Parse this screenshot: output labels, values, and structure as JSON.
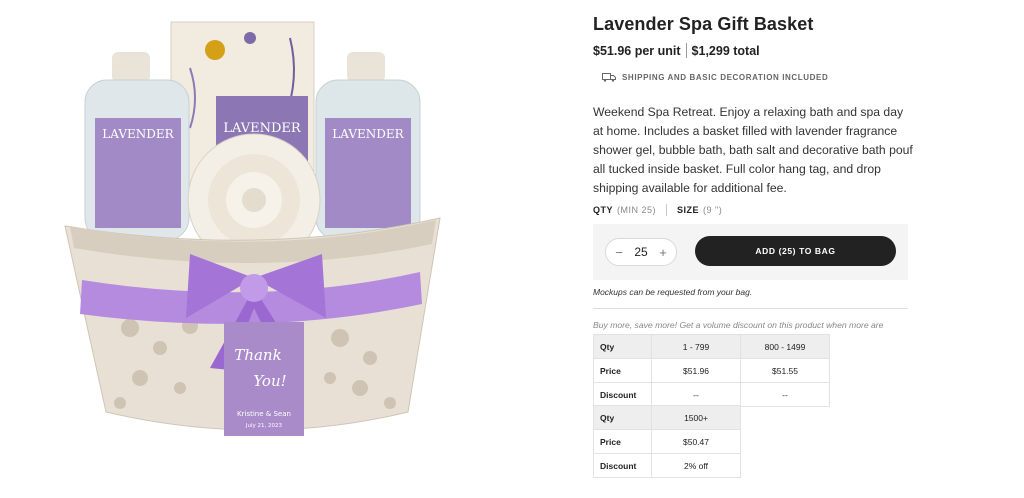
{
  "product": {
    "title": "Lavender Spa Gift Basket",
    "unit_price": "$51.96 per unit",
    "total_price": "$1,299 total",
    "shipping_note": "SHIPPING AND BASIC DECORATION INCLUDED",
    "description": "Weekend Spa Retreat. Enjoy a relaxing bath and spa day at home. Includes a basket filled with lavender fragrance shower gel, bubble bath, bath salt and decorative bath pouf all tucked inside basket. Full color hang tag, and drop shipping available for additional fee."
  },
  "options": {
    "qty_label": "QTY",
    "qty_min": "(MIN 25)",
    "size_label": "SIZE",
    "size_value": "(9 \")"
  },
  "cart": {
    "minus": "−",
    "quantity": "25",
    "plus": "+",
    "add_label": "ADD (25) TO BAG",
    "mockups_note": "Mockups can be requested from your bag."
  },
  "volume_note": "Buy more, save more! Get a volume discount on this product when more are ordered.",
  "pricing_table_1": {
    "row_labels": [
      "Qty",
      "Price",
      "Discount"
    ],
    "columns": [
      {
        "qty": "1 - 799",
        "price": "$51.96",
        "discount": "--"
      },
      {
        "qty": "800 - 1499",
        "price": "$51.55",
        "discount": "--"
      }
    ]
  },
  "pricing_table_2": {
    "row_labels": [
      "Qty",
      "Price",
      "Discount"
    ],
    "columns": [
      {
        "qty": "1500+",
        "price": "$50.47",
        "discount": "2% off"
      }
    ]
  },
  "image": {
    "bottle_label": "LAVENDER",
    "tag_text_1": "Thank",
    "tag_text_2": "You!",
    "tag_names": "Kristine & Sean",
    "tag_date": "July 21, 2023"
  },
  "colors": {
    "accent": "#222222",
    "lavender": "#9b7fc0",
    "ribbon": "#b58be0",
    "basket": "#e8e0d4"
  },
  "icons": {
    "shipping": "truck-icon"
  }
}
